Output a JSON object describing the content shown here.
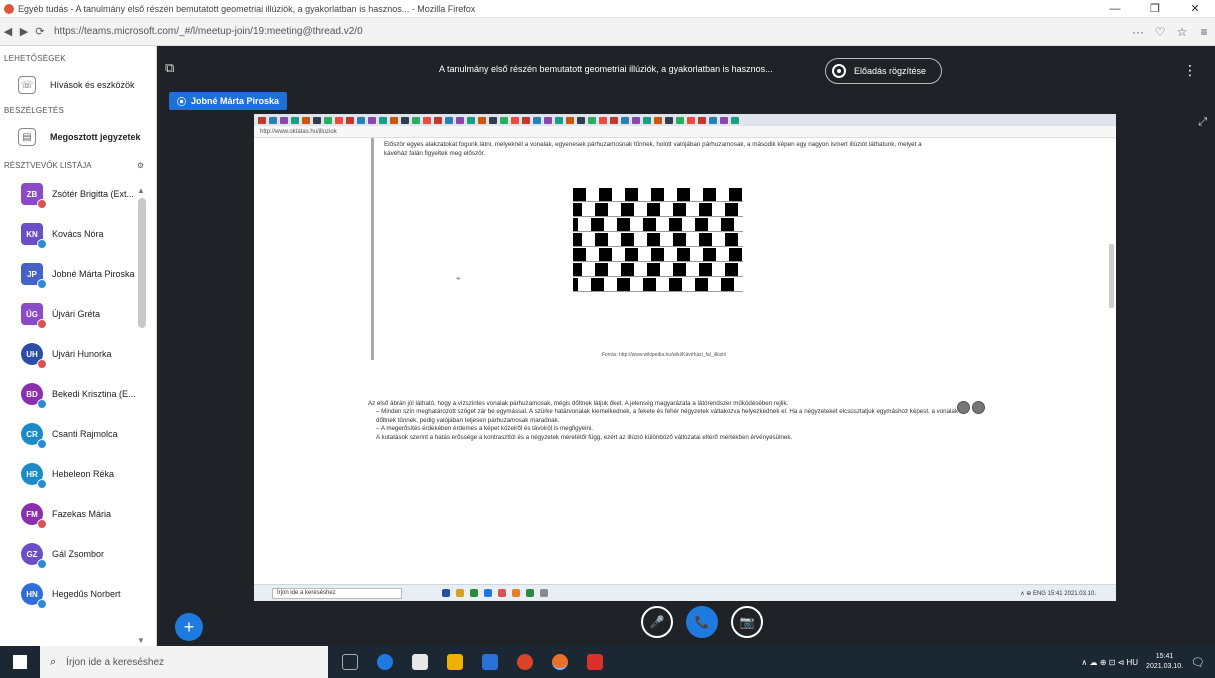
{
  "browser": {
    "title": "Egyéb tudás - A tanulmány első részén bemutatott geometriai illúziók, a gyakorlatban is hasznos... - Mozilla Firefox",
    "url": "https://teams.microsoft.com/_#/l/meetup-join/19:meeting@thread.v2/0",
    "window_controls": [
      "—",
      "❐",
      "✕"
    ],
    "nav": [
      "◀",
      "▶",
      "⟳"
    ],
    "url_right": [
      "···",
      "♡",
      "☆",
      "≡"
    ]
  },
  "sidebar": {
    "section1_label": "Lehetőségek",
    "row1": {
      "label": "Hívások és eszközök",
      "icon": "phone-icon"
    },
    "section2_label": "Beszélgetés",
    "row2": {
      "label": "Megosztott jegyzetek",
      "icon": "notes-icon"
    },
    "participants_label": "Résztvevők listája",
    "participants": [
      {
        "initials": "ZB",
        "name": "Zsótér Brigitta (Ext...",
        "color": "#8b4ac9",
        "dot": "#d9534f",
        "square": true
      },
      {
        "initials": "KN",
        "name": "Kovács Nóra",
        "color": "#6b4fc7",
        "dot": "#2f8ad9",
        "square": true
      },
      {
        "initials": "JP",
        "name": "Jobné Márta Piroska",
        "color": "#4662c9",
        "dot": "#2f8ad9",
        "square": true
      },
      {
        "initials": "ÚG",
        "name": "Újvári Gréta",
        "color": "#8b4ac9",
        "dot": "#d9534f",
        "square": true
      },
      {
        "initials": "UH",
        "name": "Ujvári Hunorka",
        "color": "#2b4fa8",
        "dot": "#d9534f",
        "square": false
      },
      {
        "initials": "BD",
        "name": "Bekedi Krisztina (E...",
        "color": "#8b2fb0",
        "dot": "#2f8ad9",
        "square": false
      },
      {
        "initials": "CR",
        "name": "Csanti Rajmolca",
        "color": "#1a8ac9",
        "dot": "#2f8ad9",
        "square": false
      },
      {
        "initials": "HR",
        "name": "Hebeleon Réka",
        "color": "#1a8ac9",
        "dot": "#2f8ad9",
        "square": false
      },
      {
        "initials": "FM",
        "name": "Fazekas Mária",
        "color": "#8b2fb0",
        "dot": "#d9534f",
        "square": false
      },
      {
        "initials": "GZ",
        "name": "Gál Zsombor",
        "color": "#6b4fc7",
        "dot": "#2f8ad9",
        "square": false
      },
      {
        "initials": "HN",
        "name": "Hegedűs Norbert",
        "color": "#2f6ed9",
        "dot": "#2f8ad9",
        "square": false
      }
    ]
  },
  "meeting": {
    "title": "A tanulmány első részén bemutatott geometriai illúziók, a gyakorlatban is hasznos...",
    "live_label": "Előadás rögzítése",
    "presenter": "Jobné Márta Piroska",
    "more": "⋮",
    "expand": "⤢",
    "add": "+",
    "controls": [
      "🎤",
      "📞",
      "📷"
    ]
  },
  "shared": {
    "url": "http://www.oktatas.hu/illuziok",
    "intro": "Először egyes alakzatokat fogunk látni, melyeknél a vonalak, egyenesek párhuzamosnak tűnnek, holott valójában párhuzamosak, a második képen egy nagyon ismert illúziót láthatunk, melyet a kávéház falán figyeltek meg először.",
    "caption": "Forrás: http://www.wikipedia.hu/wiki/Kávéházi_fal_illúzió",
    "cursor": "⌖",
    "paragraph": "Az első ábrán jól látható, hogy a vízszintes vonalak párhuzamosak, mégis dőltnek látjuk őket. A jelenség magyarázata a látórendszer működésében rejlik.",
    "bullets": [
      "Minden szín meghatározott szöget zár be egymással. A szürke határvonalak kiemelkednek, a fekete és fehér négyzetek váltakozva helyezkednek el. Ha a négyzeteket elcsúsztatjuk egymáshoz képest, a vonalak dőltnek tűnnek, pedig valójában teljesen párhuzamosak maradnak.",
      "A megerősítés érdekében érdemes a képet közelről és távolról is megfigyelni.",
      "A kutatások szerint a hatás erőssége a kontraszttól és a négyzetek méretétől függ, ezért az illúzió különböző változatai eltérő mértékben érvényesülnek."
    ],
    "taskbar_search": "Írjon ide a kereséshez",
    "taskbar_tray": "∧ ⊕ ENG 15:41 2021.03.10."
  },
  "taskbar": {
    "search_placeholder": "Írjon ide a kereséshez",
    "tray": "∧ ☁ ⊕ ⊡ ⊲ HU",
    "time": "15:41",
    "date": "2021.03.10.",
    "notification": "🗨"
  },
  "colors": {
    "teams_bg": "#1f2226",
    "accent_blue": "#1f7ae0",
    "presenter_bg": "#1f6fd9"
  }
}
